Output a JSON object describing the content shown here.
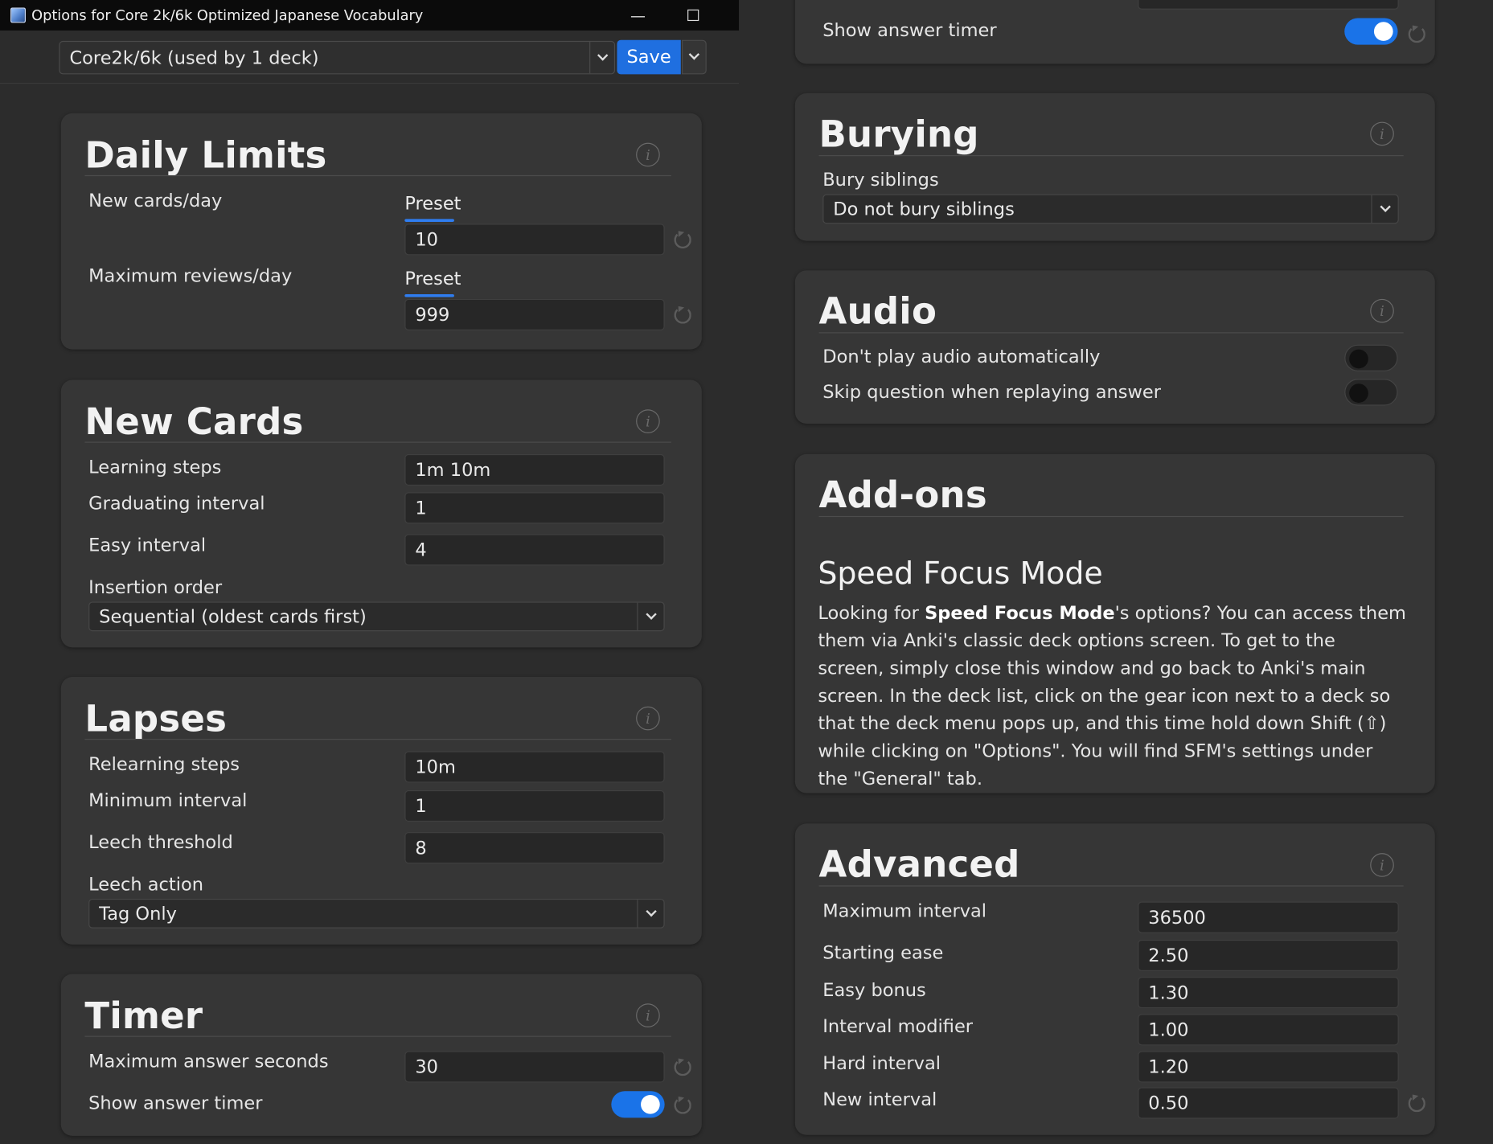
{
  "window": {
    "title": "Options for Core 2k/6k Optimized Japanese Vocabulary",
    "minimize_glyph": "—",
    "maximize_glyph": "□"
  },
  "topbar": {
    "preset_value": "Core2k/6k (used by 1 deck)",
    "save_label": "Save"
  },
  "daily_limits": {
    "title": "Daily Limits",
    "new_cards_label": "New cards/day",
    "new_cards_tab": "Preset",
    "new_cards_value": "10",
    "max_reviews_label": "Maximum reviews/day",
    "max_reviews_tab": "Preset",
    "max_reviews_value": "999"
  },
  "new_cards": {
    "title": "New Cards",
    "learning_steps_label": "Learning steps",
    "learning_steps_value": "1m 10m",
    "graduating_label": "Graduating interval",
    "graduating_value": "1",
    "easy_interval_label": "Easy interval",
    "easy_interval_value": "4",
    "insertion_label": "Insertion order",
    "insertion_value": "Sequential (oldest cards first)"
  },
  "lapses": {
    "title": "Lapses",
    "relearning_label": "Relearning steps",
    "relearning_value": "10m",
    "min_interval_label": "Minimum interval",
    "min_interval_value": "1",
    "leech_threshold_label": "Leech threshold",
    "leech_threshold_value": "8",
    "leech_action_label": "Leech action",
    "leech_action_value": "Tag Only"
  },
  "timer": {
    "title": "Timer",
    "max_seconds_label": "Maximum answer seconds",
    "max_seconds_value": "30",
    "show_timer_label": "Show answer timer",
    "show_timer_on": true
  },
  "right_top": {
    "show_timer_label": "Show answer timer",
    "show_timer_on": true
  },
  "burying": {
    "title": "Burying",
    "bury_label": "Bury siblings",
    "bury_value": "Do not bury siblings"
  },
  "audio": {
    "title": "Audio",
    "dont_play_label": "Don't play audio automatically",
    "dont_play_on": false,
    "skip_question_label": "Skip question when replaying answer",
    "skip_question_on": false
  },
  "addons": {
    "title": "Add-ons",
    "heading": "Speed Focus Mode",
    "text_before": "Looking for ",
    "text_bold": "Speed Focus Mode",
    "text_after": "'s options? You can access them them via Anki's classic deck options screen. To get to the screen, simply close this window and go back to Anki's main screen. In the deck list, click on the gear icon next to a deck so that the deck menu pops up, and this time hold down Shift (⇧) while clicking on \"Options\". You will find SFM's settings under the \"General\" tab."
  },
  "advanced": {
    "title": "Advanced",
    "max_interval_label": "Maximum interval",
    "max_interval_value": "36500",
    "starting_ease_label": "Starting ease",
    "starting_ease_value": "2.50",
    "easy_bonus_label": "Easy bonus",
    "easy_bonus_value": "1.30",
    "interval_modifier_label": "Interval modifier",
    "interval_modifier_value": "1.00",
    "hard_interval_label": "Hard interval",
    "hard_interval_value": "1.20",
    "new_interval_label": "New interval",
    "new_interval_value": "0.50"
  },
  "icons": {
    "info": "i",
    "accent_color": "#1f6fe0",
    "toggle_on_color": "#1a73e8"
  }
}
